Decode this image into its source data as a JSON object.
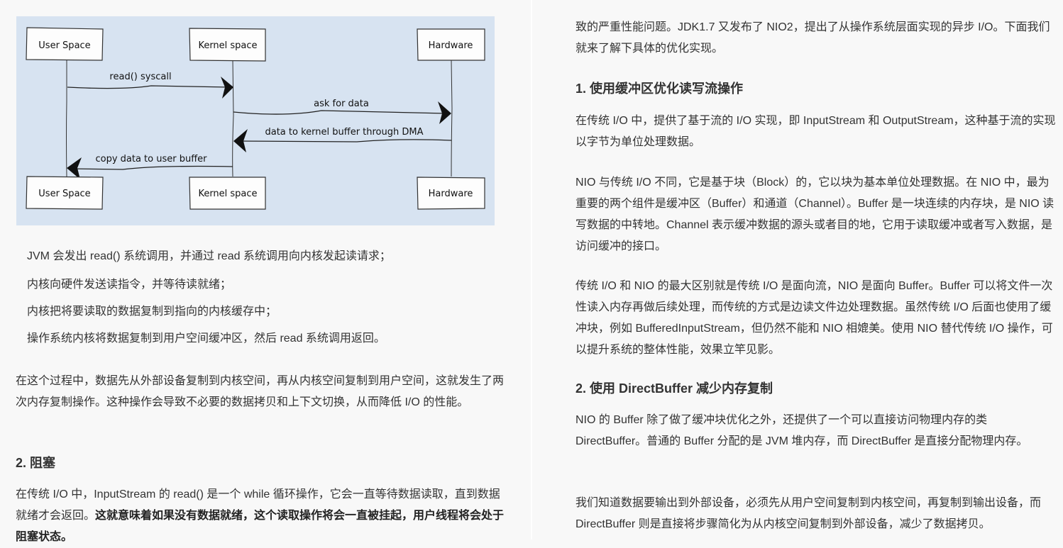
{
  "diagram": {
    "boxes_top": [
      "User Space",
      "Kernel space",
      "Hardware"
    ],
    "boxes_bottom": [
      "User Space",
      "Kernel space",
      "Hardware"
    ],
    "messages": [
      {
        "label": "read() syscall",
        "from": "User Space",
        "to": "Kernel space"
      },
      {
        "label": "ask for data",
        "from": "Kernel space",
        "to": "Hardware"
      },
      {
        "label": "data to kernel buffer through DMA",
        "from": "Hardware",
        "to": "Kernel space"
      },
      {
        "label": "copy data to user buffer",
        "from": "Kernel space",
        "to": "User Space"
      }
    ]
  },
  "left": {
    "steps": [
      "JVM 会发出 read() 系统调用，并通过 read 系统调用向内核发起读请求；",
      "内核向硬件发送读指令，并等待读就绪；",
      "内核把将要读取的数据复制到指向的内核缓存中；",
      "操作系统内核将数据复制到用户空间缓冲区，然后 read 系统调用返回。"
    ],
    "summary": "在这个过程中，数据先从外部设备复制到内核空间，再从内核空间复制到用户空间，这就发生了两次内存复制操作。这种操作会导致不必要的数据拷贝和上下文切换，从而降低 I/O 的性能。",
    "heading_blocking": "2. 阻塞",
    "blocking_text": "在传统 I/O 中，InputStream 的 read() 是一个 while 循环操作，它会一直等待数据读取，直到数据就绪才会返回。",
    "blocking_bold": "这就意味着如果没有数据就绪，这个读取操作将会一直被挂起，用户线程将会处于阻塞状态。"
  },
  "right": {
    "intro": "致的严重性能问题。JDK1.7 又发布了 NIO2，提出了从操作系统层面实现的异步 I/O。下面我们就来了解下具体的优化实现。",
    "heading1": "1. 使用缓冲区优化读写流操作",
    "p1": "在传统 I/O 中，提供了基于流的 I/O 实现，即 InputStream 和 OutputStream，这种基于流的实现以字节为单位处理数据。",
    "p2": "NIO 与传统 I/O 不同，它是基于块（Block）的，它以块为基本单位处理数据。在 NIO 中，最为重要的两个组件是缓冲区（Buffer）和通道（Channel）。Buffer 是一块连续的内存块，是 NIO 读写数据的中转地。Channel 表示缓冲数据的源头或者目的地，它用于读取缓冲或者写入数据，是访问缓冲的接口。",
    "p3": "传统 I/O 和 NIO 的最大区别就是传统 I/O 是面向流，NIO 是面向 Buffer。Buffer 可以将文件一次性读入内存再做后续处理，而传统的方式是边读文件边处理数据。虽然传统 I/O 后面也使用了缓冲块，例如 BufferedInputStream，但仍然不能和 NIO 相媲美。使用 NIO 替代传统 I/O 操作，可以提升系统的整体性能，效果立竿见影。",
    "heading2": "2. 使用 DirectBuffer 减少内存复制",
    "p4": "NIO 的 Buffer 除了做了缓冲块优化之外，还提供了一个可以直接访问物理内存的类 DirectBuffer。普通的 Buffer 分配的是 JVM 堆内存，而 DirectBuffer 是直接分配物理内存。",
    "p5": "我们知道数据要输出到外部设备，必须先从用户空间复制到内核空间，再复制到输出设备，而 DirectBuffer 则是直接将步骤简化为从内核空间复制到外部设备，减少了数据拷贝。"
  }
}
